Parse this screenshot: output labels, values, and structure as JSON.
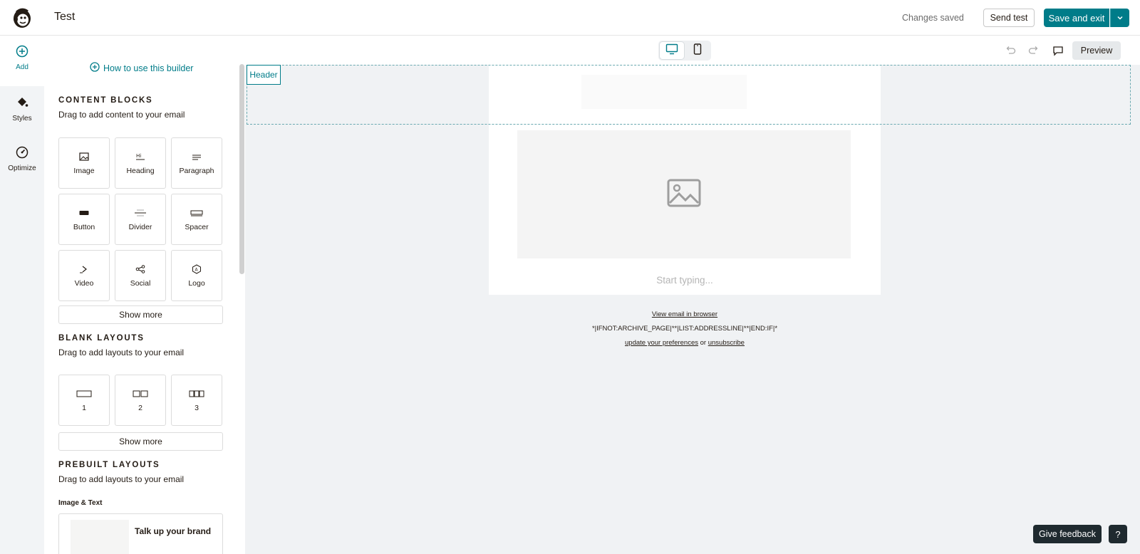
{
  "app": {
    "title": "Test",
    "status": "Changes saved",
    "send_test_label": "Send test",
    "save_label": "Save and exit"
  },
  "rail": {
    "add_label": "Add",
    "styles_label": "Styles",
    "optimize_label": "Optimize"
  },
  "panel": {
    "help_link": "How to use this builder",
    "content_blocks": {
      "title": "CONTENT BLOCKS",
      "subtitle": "Drag to add content to your email",
      "tiles": [
        "Image",
        "Heading",
        "Paragraph",
        "Button",
        "Divider",
        "Spacer",
        "Video",
        "Social",
        "Logo"
      ],
      "show_more": "Show more"
    },
    "blank_layouts": {
      "title": "BLANK LAYOUTS",
      "subtitle": "Drag to add layouts to your email",
      "tiles": [
        "1",
        "2",
        "3"
      ],
      "show_more": "Show more"
    },
    "prebuilt_layouts": {
      "title": "PREBUILT LAYOUTS",
      "subtitle": "Drag to add layouts to your email",
      "group_label": "Image & Text",
      "card_text": "Talk up your brand"
    }
  },
  "canvas": {
    "preview_label": "Preview",
    "header_tag": "Header",
    "placeholder": "Start typing...",
    "footer": {
      "view_in_browser": "View email in browser",
      "merge_line": "*|IFNOT:ARCHIVE_PAGE|**|LIST:ADDRESSLINE|**|END:IF|*",
      "update_prefs": "update your preferences",
      "or": "or",
      "unsubscribe": "unsubscribe"
    }
  },
  "feedback": {
    "give_feedback": "Give feedback",
    "help": "?"
  },
  "colors": {
    "accent": "#007c89",
    "canvas_bg": "#f0f2f4",
    "dark_button": "#1f2a2f"
  }
}
